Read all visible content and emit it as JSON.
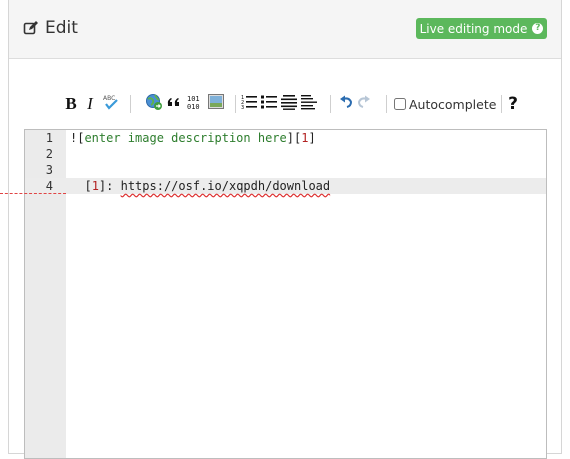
{
  "header": {
    "title": "Edit",
    "live_button": "Live editing mode"
  },
  "toolbar": {
    "bold": "B",
    "italic": "I",
    "autocomplete_label": "Autocomplete",
    "help": "?",
    "undo_label": "undo",
    "redo_label": "redo"
  },
  "icons": {
    "edit": "edit-square-icon",
    "spellcheck": "spellcheck-icon",
    "link": "globe-link-icon",
    "quote": "quote-icon",
    "code": "binary-code-icon",
    "image": "image-icon",
    "ordered_list": "ordered-list-icon",
    "bullet_list": "bullet-list-icon",
    "heading": "heading-icon",
    "hrule": "horizontal-rule-icon",
    "undo": "undo-icon",
    "redo": "redo-icon"
  },
  "editor": {
    "lines": [
      {
        "number": "1",
        "prefix": "![",
        "alt": "enter image description here",
        "mid": "][",
        "ref": "1",
        "suffix": "]"
      },
      {
        "number": "2"
      },
      {
        "number": "3"
      },
      {
        "number": "4",
        "indent": "  [",
        "ref": "1",
        "sep": "]: ",
        "url": "https://osf.io/xqpdh/download"
      }
    ]
  },
  "colors": {
    "live_button": "#5cb85c",
    "alt_text": "#2d7d2d",
    "reference": "#b22222",
    "header_bg": "#f5f5f5",
    "gutter_bg": "#ebebeb"
  }
}
